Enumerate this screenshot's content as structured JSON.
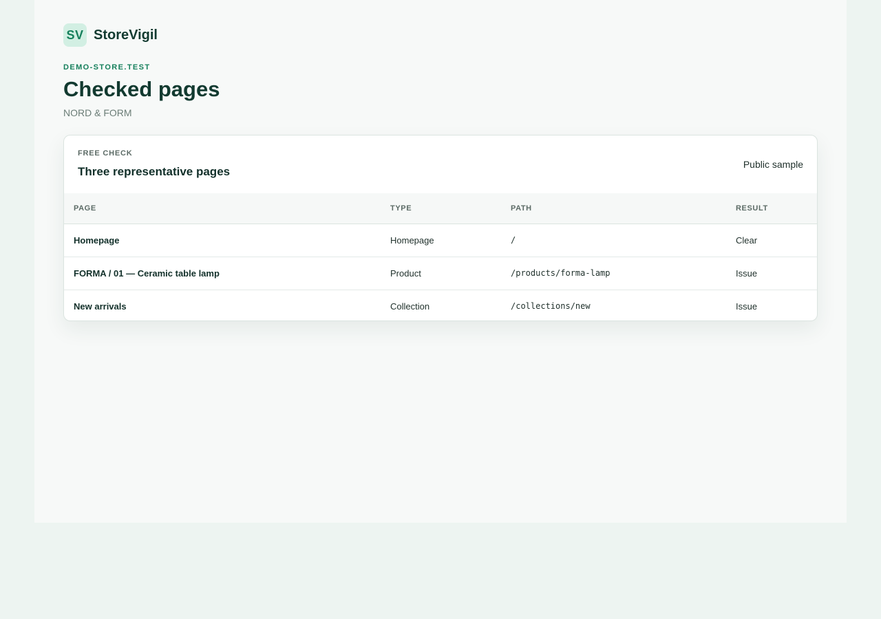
{
  "brand": {
    "logo_text": "SV",
    "name": "StoreVigil"
  },
  "header": {
    "domain": "DEMO-STORE.TEST",
    "title": "Checked pages",
    "store_name": "NORD & FORM"
  },
  "card": {
    "eyebrow": "FREE CHECK",
    "title": "Three representative pages",
    "badge": "Public sample",
    "columns": [
      "PAGE",
      "TYPE",
      "PATH",
      "RESULT"
    ],
    "rows": [
      {
        "page": "Homepage",
        "type": "Homepage",
        "path": "/",
        "result": "Clear"
      },
      {
        "page": "FORMA / 01 — Ceramic table lamp",
        "type": "Product",
        "path": "/products/forma-lamp",
        "result": "Issue"
      },
      {
        "page": "New arrivals",
        "type": "Collection",
        "path": "/collections/new",
        "result": "Issue"
      }
    ]
  },
  "colors": {
    "accent": "#16805c",
    "heading": "#123a30",
    "background": "#edf4f1",
    "surface": "#f7f9f8"
  }
}
